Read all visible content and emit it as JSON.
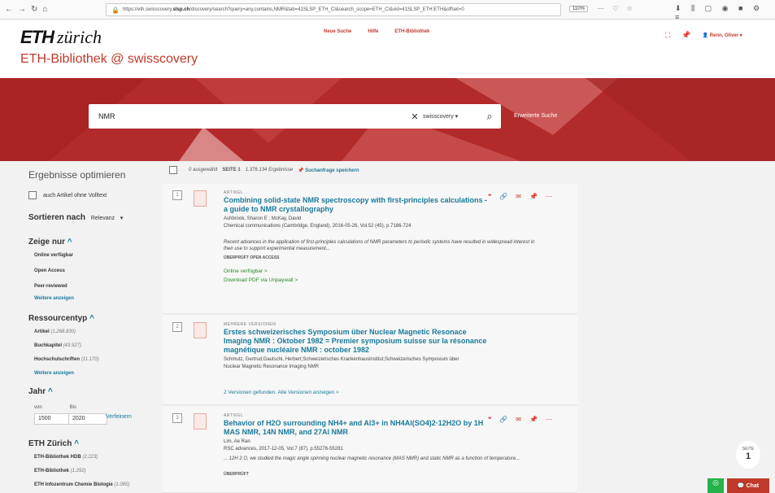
{
  "browser": {
    "url_pre": "https://eth.swisscovery.",
    "url_bold": "slsp.ch",
    "url_post": "/discovery/search?query=any,contains,NMR&tab=41SLSP_ETH_CI&search_scope=ETH_CI&vid=41SLSP_ETH:ETH&offset=0",
    "zoom": "110%"
  },
  "header": {
    "logo": "ETH",
    "logo_sub": "zürich",
    "subtitle": "ETH-Bibliothek @ swisscovery",
    "links": [
      "Neue Suche",
      "Hilfe",
      "ETH-Bibliothek"
    ],
    "user": "Renn, Oliver"
  },
  "search": {
    "query": "NMR",
    "scope": "swisscovery",
    "advanced": "Erweiterte Suche"
  },
  "sidebar": {
    "title": "Ergebnisse optimieren",
    "fulltext": "auch Artikel ohne Volltext",
    "sort_label": "Sortieren nach",
    "sort_value": "Relevanz",
    "show_only": {
      "label": "Zeige nur",
      "items": [
        "Online verfügbar",
        "Open Access",
        "Peer-reviewed"
      ],
      "more": "Weitere anzeigen"
    },
    "restype": {
      "label": "Ressourcentyp",
      "items": [
        {
          "name": "Artikel",
          "count": "(1.268.830)"
        },
        {
          "name": "Buchkapitel",
          "count": "(43.927)"
        },
        {
          "name": "Hochschulschriften",
          "count": "(11.170)"
        }
      ],
      "more": "Weitere anzeigen"
    },
    "year": {
      "label": "Jahr",
      "from_label": "von",
      "to_label": "Bis",
      "from": "1500",
      "to": "2020",
      "refine": "Verfeinern"
    },
    "eth": {
      "label": "ETH Zürich",
      "items": [
        {
          "name": "ETH-Bibliothek HDB",
          "count": "(2.223)"
        },
        {
          "name": "ETH-Bibliothek",
          "count": "(1.292)"
        },
        {
          "name": "ETH Infozentrum Chemie Biologie",
          "count": "(1.085)"
        }
      ]
    }
  },
  "results": {
    "selected": "0 ausgewählt",
    "page": "SEITE 1",
    "count": "1.376.134 Ergebnisse",
    "save": "Suchanfrage speichern",
    "items": [
      {
        "num": "1",
        "type": "ARTIKEL",
        "title": "Combining solid-state NMR spectroscopy with first-principles calculations - a guide to NMR crystallography",
        "authors": "Ashbrook, Sharon E ; McKay, David",
        "source": "Chemical communications (Cambridge, England), 2016-05-26, Vol.52 (45), p.7186-724",
        "abstract": "Recent advances in the application of first-principles calculations of NMR parameters to periodic systems have resulted in widespread interest in their use to support experimental measurement...",
        "tags": "ÜBERPRÜFT   OPEN ACCESS",
        "link1": "Online verfügbar >",
        "link2": "Download PDF via Unpaywall >"
      },
      {
        "num": "2",
        "type": "MEHRERE VERSIONEN",
        "title": "Erstes schweizerisches Symposium über Nuclear Magnetic Resonace Imaging NMR : Oktober 1982 = Premier symposium suisse sur la résonance magnétique nucléaire NMR : october 1982",
        "authors": "Schmutz, Gertrud;Gautschi, Herbert;Schweizerisches Krankenhausinstitut;Schweizerisches Symposium über",
        "source": "Nuclear Magnetic Resonance Imaging NMR",
        "versions": "2 Versionen gefunden. Alle Versionen anzeigen >"
      },
      {
        "num": "3",
        "type": "ARTIKEL",
        "title": "Behavior of H2O surrounding NH4+ and Al3+ in NH4Al(SO4)2·12H2O by 1H MAS NMR, 14N NMR, and 27Al NMR",
        "authors": "Lim, Ae Ran",
        "source": "RSC advances, 2017-12-05, Vol.7 (87), p.55276-55281",
        "abstract": "... 12H 2 O, we studied the magic angle spinning nuclear magnetic resonance (MAS NMR) and static NMR as a function of temperature...",
        "tags": "ÜBERPRÜFT"
      }
    ]
  },
  "pager": {
    "label": "SEITE",
    "page": "1"
  },
  "chat": "Chat"
}
